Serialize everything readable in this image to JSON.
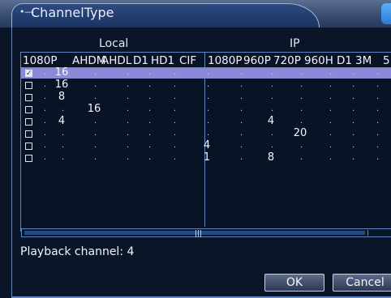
{
  "window": {
    "title": "ChannelType",
    "title_icon": "mouse-icon"
  },
  "groups": {
    "local": "Local",
    "ip": "IP"
  },
  "columns": {
    "local": [
      "1080P",
      "AHDM",
      "AHDL",
      "D1",
      "HD1",
      "CIF"
    ],
    "ip": [
      "1080P",
      "960P",
      "720P",
      "960H",
      "D1",
      "3M",
      "5"
    ]
  },
  "rows": [
    {
      "checked": true,
      "local": [
        "",
        "16",
        "",
        "",
        "",
        ""
      ],
      "ip": [
        "",
        "",
        "",
        "",
        "",
        "",
        ""
      ]
    },
    {
      "checked": false,
      "local": [
        "",
        "16",
        "",
        "",
        "",
        ""
      ],
      "ip": [
        "",
        "",
        "",
        "",
        "",
        "",
        ""
      ]
    },
    {
      "checked": false,
      "local": [
        "",
        "8",
        "",
        "",
        "",
        ""
      ],
      "ip": [
        "",
        "",
        "",
        "",
        "",
        "",
        ""
      ]
    },
    {
      "checked": false,
      "local": [
        "",
        "",
        "16",
        "",
        "",
        ""
      ],
      "ip": [
        "",
        "",
        "",
        "",
        "",
        "",
        ""
      ]
    },
    {
      "checked": false,
      "local": [
        "",
        "4",
        "",
        "",
        "",
        ""
      ],
      "ip": [
        "",
        "",
        "4",
        "",
        "",
        "",
        ""
      ]
    },
    {
      "checked": false,
      "local": [
        "",
        "",
        "",
        "",
        "",
        ""
      ],
      "ip": [
        "",
        "",
        "",
        "20",
        "",
        "",
        ""
      ]
    },
    {
      "checked": false,
      "local": [
        "",
        "",
        "",
        "",
        "",
        ""
      ],
      "ip": [
        "4",
        "",
        "",
        "",
        "",
        "",
        ""
      ]
    },
    {
      "checked": false,
      "local": [
        "",
        "",
        "",
        "",
        "",
        ""
      ],
      "ip": [
        "1",
        "",
        "8",
        "",
        "",
        "",
        ""
      ]
    }
  ],
  "empty_marker": ".",
  "playback": "Playback channel: 4",
  "buttons": {
    "ok": "OK",
    "cancel": "Cancel"
  },
  "colors": {
    "selected_row": "#8c89d8",
    "border": "#5e86c6",
    "background": "#0b1528"
  }
}
